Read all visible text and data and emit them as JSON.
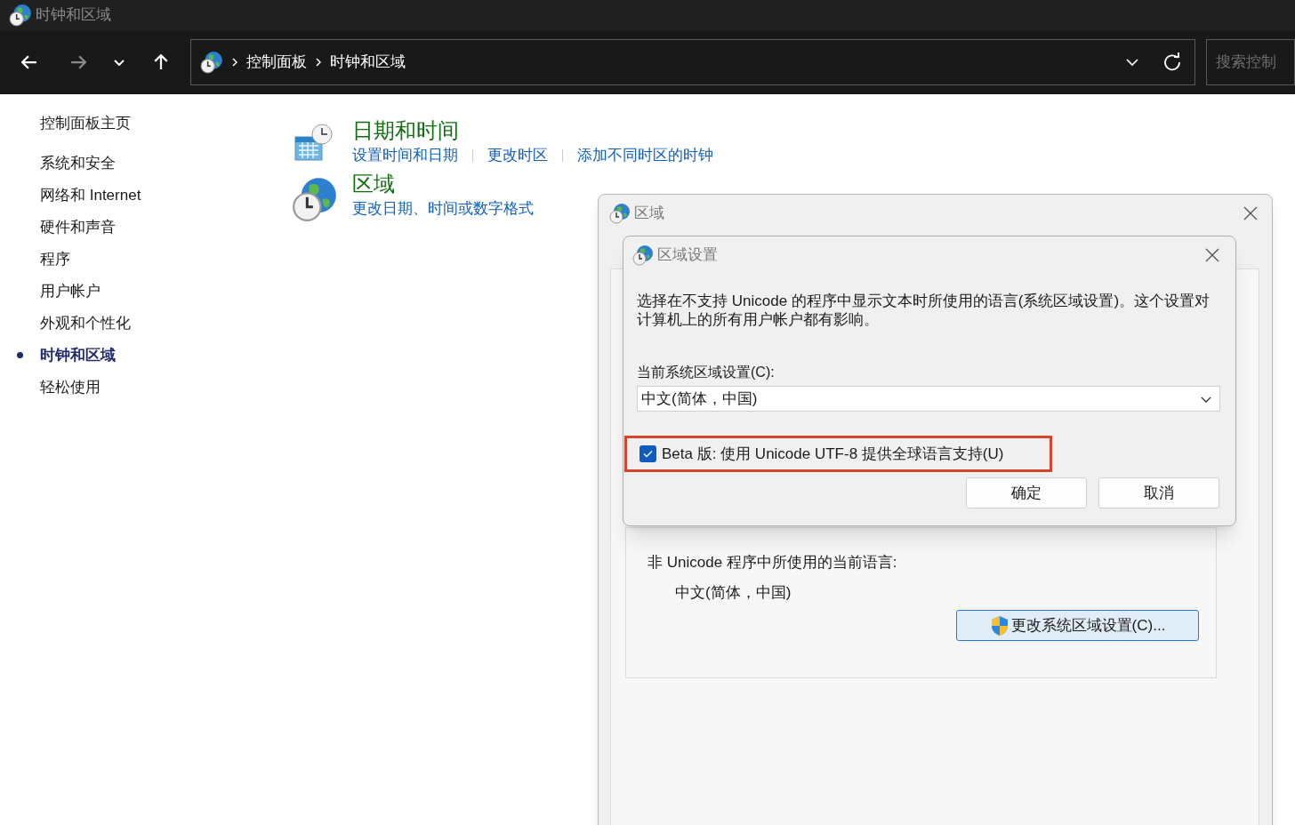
{
  "window": {
    "title": "时钟和区域"
  },
  "address_bar": {
    "breadcrumb": [
      "控制面板",
      "时钟和区域"
    ],
    "search_placeholder": "搜索控制"
  },
  "sidebar": {
    "home": "控制面板主页",
    "items": [
      {
        "label": "系统和安全",
        "selected": false
      },
      {
        "label": "网络和 Internet",
        "selected": false
      },
      {
        "label": "硬件和声音",
        "selected": false
      },
      {
        "label": "程序",
        "selected": false
      },
      {
        "label": "用户帐户",
        "selected": false
      },
      {
        "label": "外观和个性化",
        "selected": false
      },
      {
        "label": "时钟和区域",
        "selected": true
      },
      {
        "label": "轻松使用",
        "selected": false
      }
    ]
  },
  "categories": [
    {
      "kind": "calendar",
      "title": "日期和时间",
      "links": [
        "设置时间和日期",
        "更改时区",
        "添加不同时区的时钟"
      ]
    },
    {
      "kind": "globe",
      "title": "区域",
      "links": [
        "更改日期、时间或数字格式"
      ]
    }
  ],
  "region_dialog": {
    "title": "区域",
    "current_language_label": "非 Unicode 程序中所使用的当前语言:",
    "current_language": "中文(简体，中国)",
    "change_button": "更改系统区域设置(C)..."
  },
  "region_settings_dialog": {
    "title": "区域设置",
    "description": "选择在不支持 Unicode 的程序中显示文本时所使用的语言(系统区域设置)。这个设置对计算机上的所有用户帐户都有影响。",
    "locale_label": "当前系统区域设置(C):",
    "locale_value": "中文(简体，中国)",
    "utf8_checkbox": {
      "label": "Beta 版: 使用 Unicode UTF-8 提供全球语言支持(U)",
      "checked": true,
      "highlighted": true
    },
    "buttons": [
      "确定",
      "取消"
    ]
  }
}
